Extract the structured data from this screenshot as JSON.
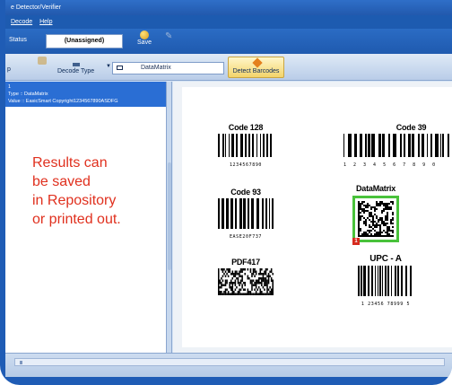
{
  "window": {
    "title": "e Detector/Verifier"
  },
  "menu": {
    "items": [
      "Decode",
      "Help"
    ]
  },
  "toolbar1": {
    "status_label": "Status",
    "status_value": "(Unassigned)",
    "save_label": "Save"
  },
  "toolbar2": {
    "left_edge": "p",
    "decode_type_label": "Decode Type",
    "decode_type_value": "DataMatrix",
    "detect_label": "Detect Barcodes"
  },
  "results": {
    "line1": "1",
    "line2": "Type :: DataMatrix",
    "line3": "Value :: EasicSmart Copyright1234567890ASDFG"
  },
  "caption": {
    "line1": "Results can",
    "line2": "be saved",
    "line3": "in Repository",
    "line4": "or printed out."
  },
  "barcodes": {
    "code128": {
      "label": "Code 128",
      "digits": "1234567890"
    },
    "code39": {
      "label": "Code 39",
      "digits": "1 2 3 4 5 6 7 8 9 0"
    },
    "code93": {
      "label": "Code 93",
      "digits": "EASE20F737"
    },
    "datamatrix": {
      "label": "DataMatrix",
      "badge": "1"
    },
    "pdf417": {
      "label": "PDF417"
    },
    "upca": {
      "label": "UPC - A",
      "digits": "1 23456 78999 5"
    }
  },
  "colors": {
    "accent_blue": "#2a6ed4",
    "caption_red": "#e0301e",
    "detect_green": "#49c23b"
  }
}
